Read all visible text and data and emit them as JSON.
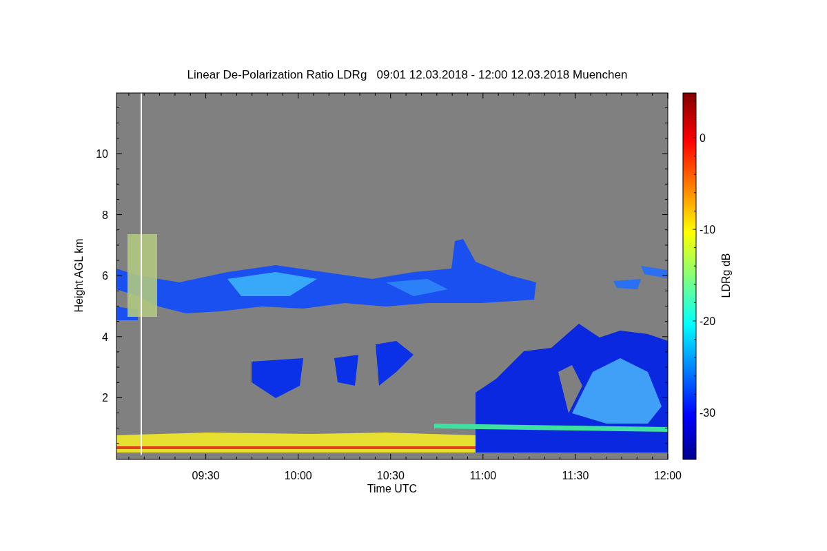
{
  "title": "Linear De-Polarization Ratio LDRg   09:01 12.03.2018 - 12:00 12.03.2018 Muenchen",
  "plot": {
    "xlabel": "Time UTC",
    "ylabel": "Height AGL km",
    "xticks": [
      "09:30",
      "10:00",
      "10:30",
      "11:00",
      "11:30",
      "12:00"
    ],
    "yticks": [
      "10",
      "8",
      "6",
      "4",
      "2"
    ]
  },
  "colorbar": {
    "label": "LDRg dB",
    "ticks": [
      "0",
      "-10",
      "-20",
      "-30"
    ]
  }
}
